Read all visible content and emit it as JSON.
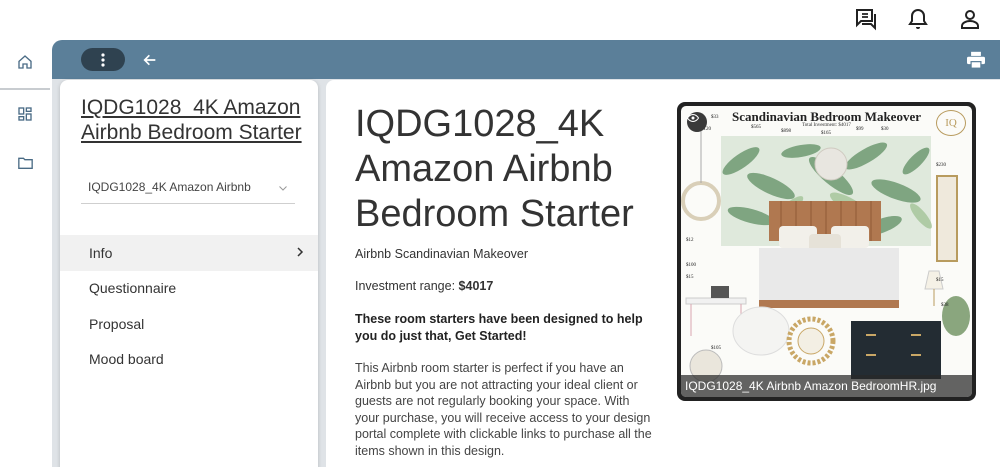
{
  "top_bar": {
    "icons": [
      "chat-icon",
      "bell-icon",
      "user-icon"
    ]
  },
  "left_rail": {
    "items": [
      "home-icon",
      "dashboard-icon",
      "folder-icon"
    ]
  },
  "toolbar": {
    "more_icon": "more-vertical-icon",
    "back_icon": "arrow-left-icon",
    "print_icon": "print-icon",
    "color": "#5b7f99"
  },
  "sidebar": {
    "title": "IQDG1028_4K Amazon Airbnb Bedroom Starter",
    "select_value": "IQDG1028_4K Amazon Airbnb",
    "nav": [
      {
        "label": "Info",
        "active": true
      },
      {
        "label": "Questionnaire",
        "active": false
      },
      {
        "label": "Proposal",
        "active": false
      },
      {
        "label": "Mood board",
        "active": false
      }
    ]
  },
  "main": {
    "title": "IQDG1028_4K Amazon Airbnb Bedroom Starter",
    "subtitle": "Airbnb Scandinavian Makeover",
    "investment_label": "Investment range:",
    "investment_value": "$4017",
    "tagline": "These room starters have been designed to help you do just that, Get Started!",
    "description": "This Airbnb room starter is perfect if you have an Airbnb but you are not attracting your ideal client or guests are not regularly booking your space. With your purchase, you will receive access to your design portal complete with clickable links to purchase all the items shown in this design."
  },
  "mood_board": {
    "board_title": "Scandinavian Bedroom Makeover",
    "board_subtitle": "Total Investment: $4017",
    "logo": "IQ",
    "caption": "IQDG1028_4K Airbnb Amazon BedroomHR.jpg"
  }
}
